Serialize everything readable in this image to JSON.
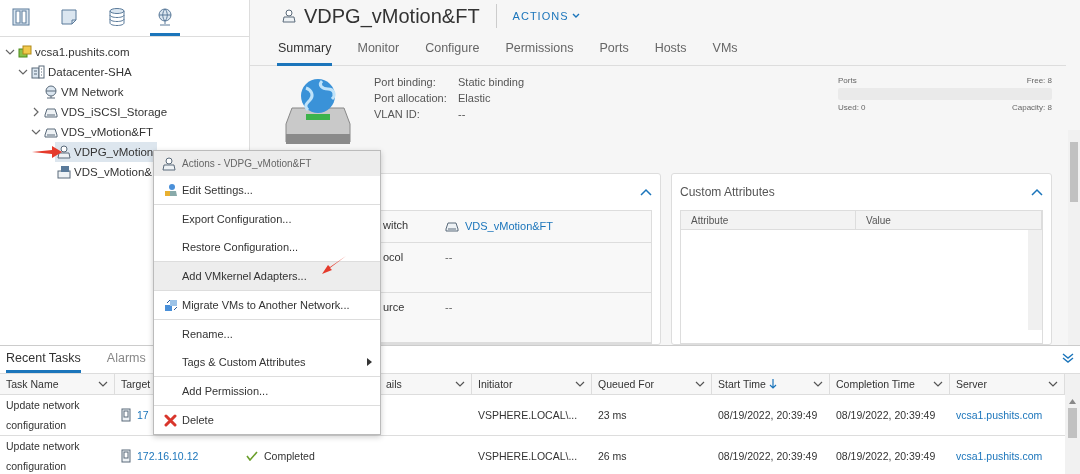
{
  "nav_icons": [
    {
      "kind": "hosts",
      "selected": false
    },
    {
      "kind": "vms",
      "selected": false
    },
    {
      "kind": "storage",
      "selected": false
    },
    {
      "kind": "network",
      "selected": true
    }
  ],
  "tree": [
    {
      "label": "vcsa1.pushits.com",
      "kind": "vcenter",
      "expanded": true,
      "selected": false,
      "children": [
        {
          "label": "Datacenter-SHA",
          "kind": "datacenter",
          "expanded": true,
          "selected": false,
          "children": [
            {
              "label": "VM Network",
              "kind": "network",
              "selected": false
            },
            {
              "label": "VDS_iSCSI_Storage",
              "kind": "switch",
              "expanded": false,
              "selected": false
            },
            {
              "label": "VDS_vMotion&FT",
              "kind": "switch",
              "expanded": true,
              "selected": false,
              "children": [
                {
                  "label": "VDPG_vMotion",
                  "kind": "portgroup",
                  "selected": true
                },
                {
                  "label": "VDS_vMotion&",
                  "kind": "uplink",
                  "selected": false
                }
              ]
            }
          ]
        }
      ]
    }
  ],
  "header": {
    "title": "VDPG_vMotion&FT",
    "actions": "ACTIONS"
  },
  "tabs": [
    {
      "label": "Summary",
      "selected": true
    },
    {
      "label": "Monitor",
      "selected": false
    },
    {
      "label": "Configure",
      "selected": false
    },
    {
      "label": "Permissions",
      "selected": false
    },
    {
      "label": "Ports",
      "selected": false
    },
    {
      "label": "Hosts",
      "selected": false
    },
    {
      "label": "VMs",
      "selected": false
    }
  ],
  "summary": {
    "properties": [
      {
        "label": "Port binding:",
        "value": "Static binding"
      },
      {
        "label": "Port allocation:",
        "value": "Elastic"
      },
      {
        "label": "VLAN ID:",
        "value": "--"
      }
    ],
    "ports": {
      "title": "Ports",
      "free": "Free: 8",
      "used": "Used: 0",
      "capacity": "Capacity: 8",
      "level": 0
    }
  },
  "details_card": {
    "rows": [
      {
        "label": "witch",
        "value": "VDS_vMotion&FT",
        "kind": "link"
      },
      {
        "label": "ocol",
        "value": "--",
        "kind": "text"
      },
      {
        "label": "urce",
        "value": "--",
        "kind": "text"
      }
    ]
  },
  "custom_attributes": {
    "title": "Custom Attributes",
    "columns": [
      "Attribute",
      "Value"
    ]
  },
  "context_menu": {
    "title": "Actions - VDPG_vMotion&FT",
    "items": [
      {
        "kind": "edit",
        "label": "Edit Settings...",
        "hovered": false
      },
      {
        "kind": "separator"
      },
      {
        "kind": "plain",
        "label": "Export Configuration...",
        "hovered": false
      },
      {
        "kind": "plain",
        "label": "Restore Configuration...",
        "hovered": false
      },
      {
        "kind": "separator"
      },
      {
        "kind": "plain",
        "label": "Add VMkernel Adapters...",
        "hovered": true
      },
      {
        "kind": "separator"
      },
      {
        "kind": "migrate",
        "label": "Migrate VMs to Another Network...",
        "hovered": false
      },
      {
        "kind": "separator"
      },
      {
        "kind": "plain",
        "label": "Rename...",
        "hovered": false
      },
      {
        "kind": "submenu",
        "label": "Tags & Custom Attributes",
        "hovered": false
      },
      {
        "kind": "separator"
      },
      {
        "kind": "plain",
        "label": "Add Permission...",
        "hovered": false
      },
      {
        "kind": "separator"
      },
      {
        "kind": "delete",
        "label": "Delete",
        "hovered": false
      }
    ]
  },
  "bottom_tabs": [
    {
      "label": "Recent Tasks",
      "selected": true
    },
    {
      "label": "Alarms",
      "selected": false
    }
  ],
  "tasks": {
    "columns": [
      {
        "label": "Task Name",
        "sorted": false
      },
      {
        "label": "Target",
        "sorted": false
      },
      {
        "label": "ails",
        "sorted": false
      },
      {
        "label": "Initiator",
        "sorted": false
      },
      {
        "label": "Queued For",
        "sorted": false
      },
      {
        "label": "Start Time",
        "sorted": true
      },
      {
        "label": "Completion Time",
        "sorted": false
      },
      {
        "label": "Server",
        "sorted": false
      }
    ],
    "rows": [
      {
        "task": "Update network configuration",
        "target": "17",
        "initiator": "VSPHERE.LOCAL\\...",
        "queued": "23 ms",
        "start": "08/19/2022, 20:39:49",
        "completion": "08/19/2022, 20:39:49",
        "server": "vcsa1.pushits.com"
      },
      {
        "task": "Update network configuration",
        "target": "172.16.10.12",
        "status": "Completed",
        "initiator": "VSPHERE.LOCAL\\...",
        "queued": "26 ms",
        "start": "08/19/2022, 20:39:49",
        "completion": "08/19/2022, 20:39:49",
        "server": "vcsa1.pushits.com"
      }
    ]
  }
}
